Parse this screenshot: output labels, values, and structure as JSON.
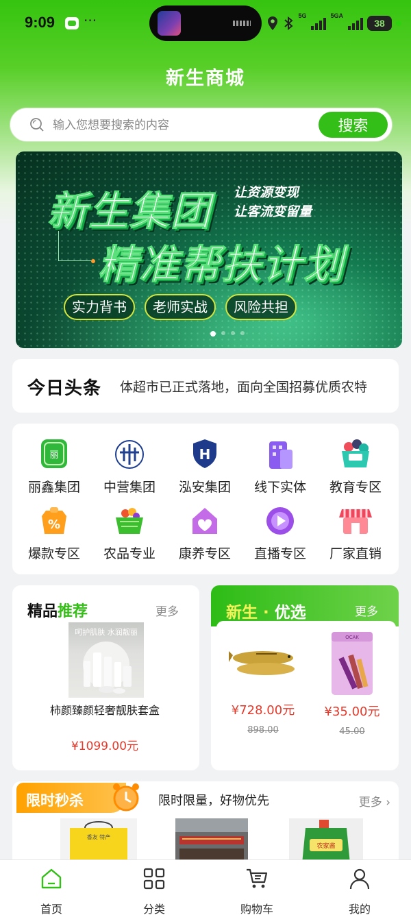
{
  "status_bar": {
    "time": "9:09",
    "dots": "···",
    "battery": "38",
    "signal1_label": "5G",
    "signal2_label": "5GA"
  },
  "app_title": "新生商城",
  "search": {
    "placeholder": "输入您想要搜索的内容",
    "button": "搜索"
  },
  "banner": {
    "headline1": "新生集团",
    "headline2": "精准帮扶计划",
    "side_line1": "让资源变现",
    "side_line2": "让客流变留量",
    "tags": [
      "实力背书",
      "老师实战",
      "风险共担"
    ]
  },
  "news": {
    "logo": "今日头条",
    "text": "体超市已正式落地，面向全国招募优质农特"
  },
  "categories": [
    {
      "label": "丽鑫集团",
      "icon": "lixin-logo-icon"
    },
    {
      "label": "中营集团",
      "icon": "zhongying-logo-icon"
    },
    {
      "label": "泓安集团",
      "icon": "hongan-logo-icon"
    },
    {
      "label": "线下实体",
      "icon": "building-icon"
    },
    {
      "label": "教育专区",
      "icon": "education-icon"
    },
    {
      "label": "爆款专区",
      "icon": "percent-tag-icon"
    },
    {
      "label": "农品专业",
      "icon": "basket-icon"
    },
    {
      "label": "康养专区",
      "icon": "health-house-icon"
    },
    {
      "label": "直播专区",
      "icon": "play-icon"
    },
    {
      "label": "厂家直销",
      "icon": "store-icon"
    }
  ],
  "recommend": {
    "title_a": "精品",
    "title_b": "推荐",
    "more": "更多",
    "product": {
      "image_caption": "呵护肌肤 水润靓丽",
      "name": "柿颜臻颜轻奢靓肤套盒",
      "price": "¥1099.00元"
    }
  },
  "optimal": {
    "title_a": "新生",
    "title_dot": "·",
    "title_b": "优选",
    "more": "更多",
    "products": [
      {
        "price": "¥728.00元",
        "old_price": "898.00"
      },
      {
        "price": "¥35.00元",
        "old_price": "45.00",
        "brand": "OCAK"
      }
    ]
  },
  "flash": {
    "tag": "限时秒杀",
    "subtitle": "限时限量，好物优先",
    "more": "更多",
    "product_labels": [
      "香友 特产",
      "农家酱"
    ]
  },
  "tabbar": [
    {
      "label": "首页",
      "icon": "home-icon"
    },
    {
      "label": "分类",
      "icon": "grid-icon"
    },
    {
      "label": "购物车",
      "icon": "cart-icon"
    },
    {
      "label": "我的",
      "icon": "user-icon"
    }
  ],
  "colors": {
    "brand": "#34be18",
    "price": "#e33a2c",
    "flash": "#ffa100"
  }
}
